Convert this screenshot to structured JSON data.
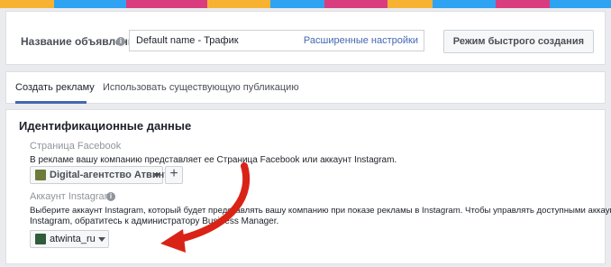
{
  "colors": {
    "top_strip": [
      "#f8b232",
      "#2ea3f2",
      "#d93c7f",
      "#f8b232",
      "#2ea3f2",
      "#d93c7f",
      "#f8b232",
      "#2ea3f2",
      "#d93c7f",
      "#2ea3f2"
    ],
    "link": "#4267b2",
    "arrow": "#d92317"
  },
  "ad_name": {
    "label": "Название объявления",
    "info_icon": "info-icon",
    "value": "Default name - Трафик",
    "advanced_link": "Расширенные настройки",
    "quick_mode_button": "Режим быстрого создания"
  },
  "tabs": [
    {
      "label": "Создать рекламу",
      "active": true
    },
    {
      "label": "Использовать существующую публикацию",
      "active": false
    }
  ],
  "identity": {
    "title": "Идентификационные данные",
    "facebook_page": {
      "label": "Страница Facebook",
      "description": "В рекламе вашу компанию представляет ее Страница Facebook или аккаунт Instagram.",
      "selected": "Digital-агентство Атвинта",
      "add_icon": "plus-icon"
    },
    "instagram": {
      "label": "Аккаунт Instagram",
      "info_icon": "info-icon",
      "description_line1": "Выберите аккаунт Instagram, который будет представлять вашу компанию при показе рекламы в Instagram. Чтобы управлять доступными аккаунтами",
      "description_line2": "Instagram, обратитесь к администратору Business Manager.",
      "selected": "atwinta_ru"
    }
  }
}
